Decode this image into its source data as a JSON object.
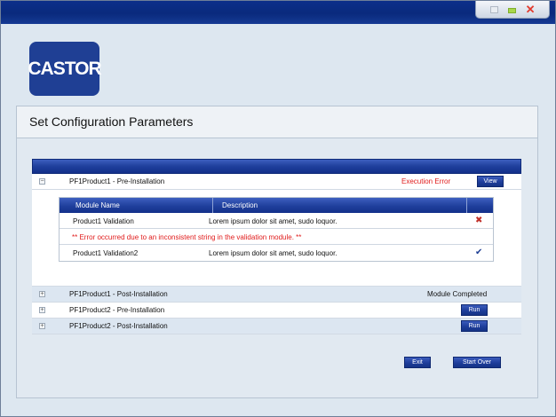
{
  "logo": {
    "text": "CASTOR"
  },
  "panel": {
    "title": "Set Configuration Parameters"
  },
  "grid": {
    "rows": [
      {
        "label": "PF1Product1 - Pre-Installation",
        "status": "Execution Error",
        "button": "View",
        "expanded": true
      },
      {
        "label": "PF1Product1 - Post-Installation",
        "status": "Module Completed",
        "button": ""
      },
      {
        "label": "PF1Product2 - Pre-Installation",
        "status": "",
        "button": "Run"
      },
      {
        "label": "PF1Product2 - Post-Installation",
        "status": "",
        "button": "Run"
      }
    ],
    "subtable": {
      "headers": [
        "Module Name",
        "Description"
      ],
      "rows": [
        {
          "name": "Product1 Validation",
          "description": "Lorem ipsum dolor sit amet, sudo loquor.",
          "icon": "error-x-icon"
        },
        {
          "name": "Product1 Validation2",
          "description": "Lorem ipsum dolor sit amet, sudo loquor.",
          "icon": "checkmark-icon"
        }
      ],
      "error_message": "** Error occurred due to an inconsistent string in the validation module. **"
    }
  },
  "footer": {
    "exit_label": "Exit",
    "start_over_label": "Start Over"
  },
  "colors": {
    "brand": "#1f3f94",
    "error": "#e01b1b",
    "header_bar": "#1f3f9c"
  }
}
